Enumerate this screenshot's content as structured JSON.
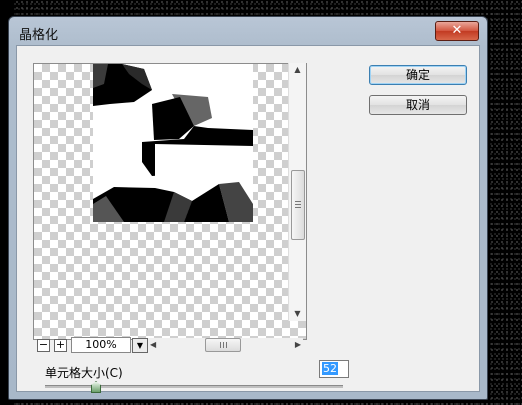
{
  "dialog": {
    "title": "晶格化",
    "close_symbol": "✕"
  },
  "buttons": {
    "ok": "确定",
    "cancel": "取消"
  },
  "preview": {
    "zoom": "100%",
    "zoom_out": "−",
    "zoom_in": "+"
  },
  "cell_size": {
    "label": "单元格大小(C)",
    "value": "52",
    "slider_min": 3,
    "slider_max": 300
  }
}
